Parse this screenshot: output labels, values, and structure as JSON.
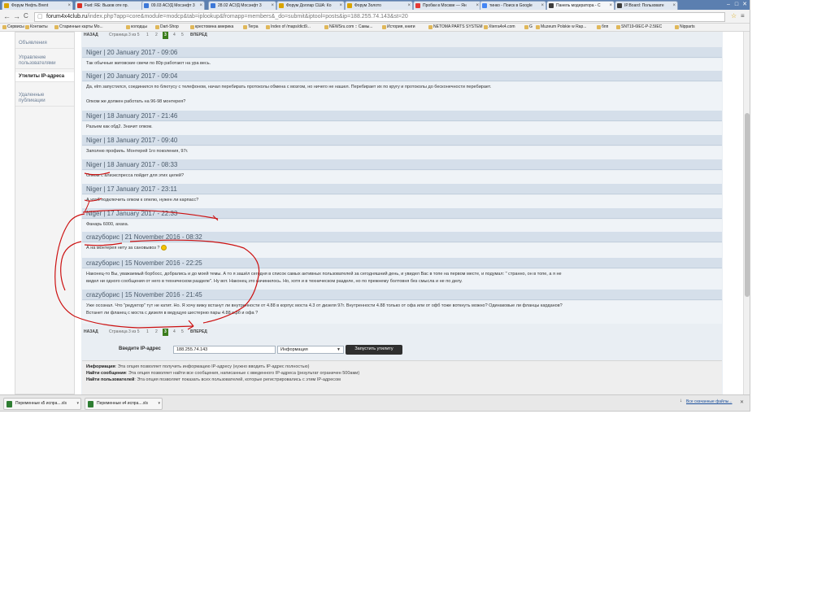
{
  "tabs": [
    {
      "label": "Форум Нефть Brent",
      "color": "#d9a400"
    },
    {
      "label": "Fwd: RE: Вызов оте пр.",
      "color": "#d93025"
    },
    {
      "label": "09.03 АСУД Мосэнфт 3",
      "color": "#3c78d8"
    },
    {
      "label": "28.02 АСУД Мосэнфт 3",
      "color": "#3c78d8"
    },
    {
      "label": "Форум Доллар США: Ко",
      "color": "#d9a400"
    },
    {
      "label": "Форум Золото",
      "color": "#d9a400"
    },
    {
      "label": "Пробки в Москве — Ян",
      "color": "#e53935"
    },
    {
      "label": "тинко - Поиск в Google",
      "color": "#4285f4"
    },
    {
      "label": "Панель модератора - С",
      "color": "#3d3d3d"
    },
    {
      "label": "IP.Board: Пользовате",
      "color": "#3d3d3d"
    }
  ],
  "window_controls": [
    "–",
    "□",
    "✕"
  ],
  "nav": {
    "back": "←",
    "forward": "→",
    "reload": "C"
  },
  "url": {
    "host": "forum4x4club.ru",
    "rest": "/index.php?app=core&module=modcp&tab=iplookup&fromapp=members&_do=submit&iptool=posts&ip=188.255.74.143&st=20"
  },
  "bookmarks": [
    "Сервисы",
    "Контакты",
    "Старинные карты Мо...",
    "колодцы",
    "Dart-Shop",
    "крестовина америка",
    "Terpa",
    "Index of /maps/dict9...",
    "NEWSru.com :: Самы...",
    "История, книги",
    "NETOMA PARTS SYSTEM",
    "Xterra4x4.com",
    "G",
    "Muzeum Polskie w Rap...",
    "бпп",
    "SNT19-6IEC-P-2.5IEC",
    "Nipparts"
  ],
  "sidebar": {
    "items": [
      {
        "label": "Объявления",
        "active": false
      },
      {
        "label": "Управление пользователями",
        "active": false
      },
      {
        "label": "Утилиты IP-адреса",
        "active": true
      },
      {
        "label": "Удаленные публикации",
        "active": false
      }
    ]
  },
  "pagination": {
    "prev": "НАЗАД",
    "info": "Страница 3 из 5",
    "pages": [
      "1",
      "2",
      "3",
      "4",
      "5"
    ],
    "current": "3",
    "next": "ВПЕРЕД"
  },
  "posts": [
    {
      "header": "Niger | 20 January 2017 - 09:06",
      "lines": [
        "Так обычные жиговские свечи по 80р работают на ура весь."
      ]
    },
    {
      "header": "Niger | 20 January 2017 - 09:04",
      "lines": [
        "Да, elm запустился, соединился по блютусу с телефоном, начал перебирать протоколы обмена с мозгом, но ничего не нашел. Перебирает их по кругу и протоколы до бесконечности перебирает.",
        "",
        "Опком же должен работать на 96-98 монтерея?"
      ]
    },
    {
      "header": "Niger | 18 January 2017 - 21:46",
      "lines": [
        "Разъем как обд2. Значит опком."
      ]
    },
    {
      "header": "Niger | 18 January 2017 - 09:40",
      "lines": [
        "Заполню профиль. Монтерей 1го поколения, 97г."
      ]
    },
    {
      "header": "Niger | 18 January 2017 - 08:33",
      "lines": [
        "Опком с алиэкспресса пойдет для этих целей?"
      ]
    },
    {
      "header": "Niger | 17 January 2017 - 23:11",
      "lines": [
        "А чтоб подключить опком к опелю, нужен ли карпасс?"
      ]
    },
    {
      "header": "Niger | 17 January 2017 - 22:33",
      "lines": [
        "Фанарь 6000, ахаха."
      ]
    },
    {
      "header": "crazyборис | 21 November 2016 - 08:32",
      "lines": [
        "А на монтерея нету за сановывоз ?"
      ]
    },
    {
      "header": "crazyборис | 15 November 2016 - 22:25",
      "lines": [
        "Наконец-то Вы, уважаемый борбосс, добрались и до моей темы. А то я зашёл сегодня в список самых активных пользователей за сегодняшний день, и увидел Вас в топе на первом месте, и подумал: \" странно, он в топе, а я не",
        "видел ни одного сообщения от него в техническом разделе\". Ну вот. Наконец это начинилось. Но, хотя и в техническом разделе, но по прежнему болтовня без смысла и не по делу."
      ]
    },
    {
      "header": "crazyборис | 15 November 2016 - 21:45",
      "lines": [
        "Уже осознал. Что \"редуктор\" тут не катит. Но. Я хочу вижу встанут ли внутренности от 4.88 в корпус моста 4.3 от дизеля 97г. Внутренности 4.88 только от офа или от офб тоже воткнуть можно? Одинаковые ли фланцы карданов?",
        "Встанет ли фланец с моста с дизеля в ведущую шестерню пары 4.88 офб и офа ?"
      ]
    }
  ],
  "form": {
    "label": "Введите IP-адрес",
    "ip_value": "188.255.74.143",
    "mode": "Информация",
    "submit": "Запустить утилиту"
  },
  "info": [
    {
      "title": "Информация",
      "text": ": Эта опция позволяет получить информацию IP-адресу (нужно вводить IP-адрес полностью)"
    },
    {
      "title": "Найти сообщения",
      "text": ": Эта опция позволяет найти все сообщения, написанные с введенного IP-адреса (результат ограничен 500ами)"
    },
    {
      "title": "Найти пользователей",
      "text": ": Эта опция позволяет показать всех пользователей, которые регистрировались с этим IP-адресом"
    }
  ],
  "downloads": {
    "items": [
      "Переменные к5 испра....xls",
      "Переменные к4 испра....xls"
    ],
    "show_all": "Все скачанные файлы...",
    "close": "✕"
  },
  "colors": {
    "active_page": "#3c7d1d",
    "annotation": "#cc1111",
    "post_header": "#d5dfea"
  }
}
